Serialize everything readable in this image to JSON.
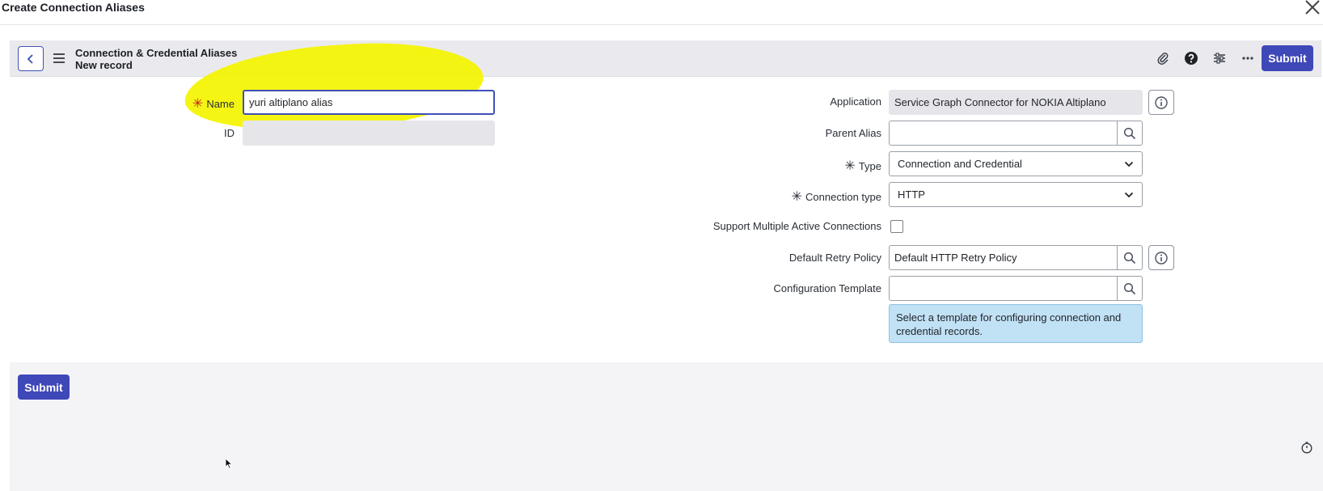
{
  "dialog": {
    "title": "Create Connection Aliases"
  },
  "header": {
    "title": "Connection & Credential Aliases",
    "subtitle": "New record",
    "submit_label": "Submit"
  },
  "form": {
    "name": {
      "label": "Name",
      "value": "yuri altiplano alias"
    },
    "id": {
      "label": "ID",
      "value": ""
    },
    "application": {
      "label": "Application",
      "value": "Service Graph Connector for NOKIA Altiplano"
    },
    "parent_alias": {
      "label": "Parent Alias",
      "value": ""
    },
    "type": {
      "label": "Type",
      "value": "Connection and Credential"
    },
    "connection_type": {
      "label": "Connection type",
      "value": "HTTP"
    },
    "multiple_active": {
      "label": "Support Multiple Active Connections",
      "checked": false
    },
    "retry_policy": {
      "label": "Default Retry Policy",
      "value": "Default HTTP Retry Policy"
    },
    "config_template": {
      "label": "Configuration Template",
      "value": "",
      "hint": "Select a template for configuring connection and credential records."
    }
  },
  "footer": {
    "submit_label": "Submit"
  },
  "colors": {
    "accent": "#3f48b8",
    "highlight": "#f4f400",
    "required": "#c9222a",
    "hint_bg": "#c1e1f5"
  }
}
